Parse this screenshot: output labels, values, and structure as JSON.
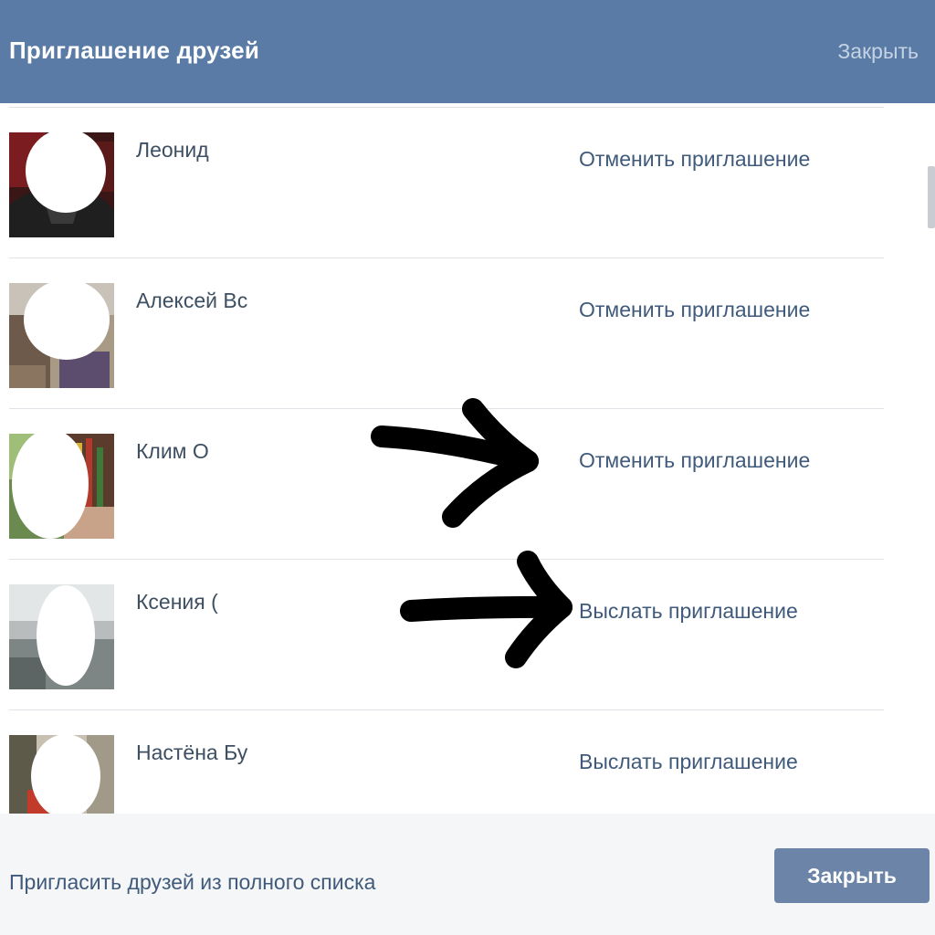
{
  "dialog": {
    "title": "Приглашение друзей",
    "close_label": "Закрыть"
  },
  "friends": [
    {
      "name": "Леонид",
      "action": "Отменить приглашение"
    },
    {
      "name": "Алексей Вс",
      "action": "Отменить приглашение"
    },
    {
      "name": "Клим О",
      "action": "Отменить приглашение"
    },
    {
      "name": "Ксения (",
      "action": "Выслать приглашение"
    },
    {
      "name": "Настёна Бу",
      "action": "Выслать приглашение"
    }
  ],
  "footer": {
    "invite_all_label": "Пригласить друзей из полного списка",
    "close_button_label": "Закрыть"
  },
  "colors": {
    "header_bg": "#5a7ba5",
    "link": "#3f5a7b",
    "button_bg": "#6b84a7",
    "annotation": "#000000"
  },
  "icons": {
    "annotation_arrow": "hand-drawn-arrow-icon"
  }
}
